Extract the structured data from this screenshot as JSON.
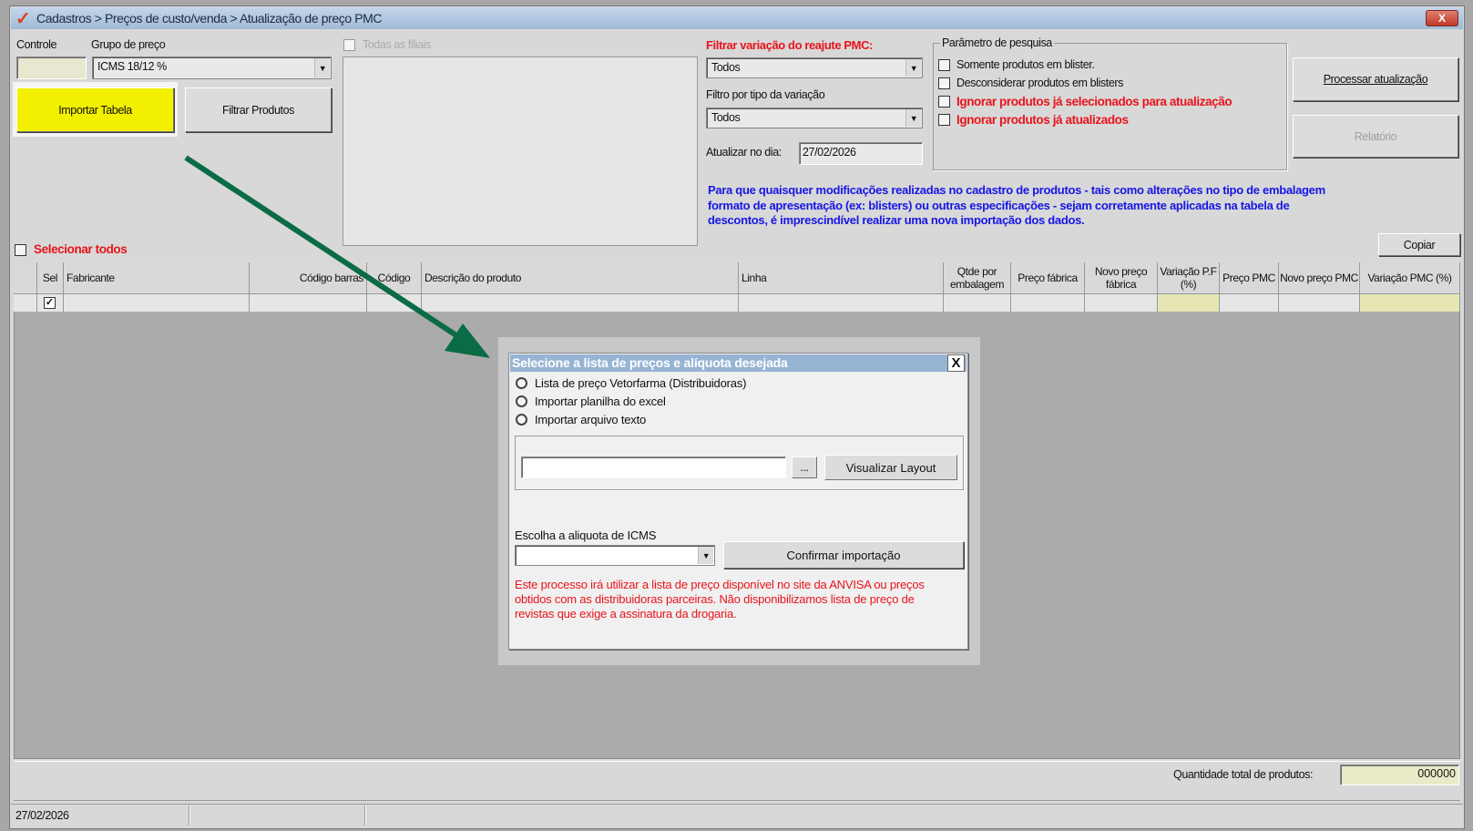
{
  "window": {
    "breadcrumb": "Cadastros > Preços de custo/venda > Atualização de preço PMC",
    "close_label": "X"
  },
  "form": {
    "controle_label": "Controle",
    "controle_value": "",
    "grupo_label": "Grupo de preço",
    "grupo_value": "ICMS 18/12 %",
    "importar_btn": "Importar Tabela",
    "filtrar_btn": "Filtrar Produtos",
    "todas_filiais": "Todas as filiais",
    "filtrar_variacao_label": "Filtrar variação do reajute PMC:",
    "filtrar_variacao_value": "Todos",
    "filtro_tipo_label": "Filtro por tipo da variação",
    "filtro_tipo_value": "Todos",
    "atualizar_label": "Atualizar no dia:",
    "atualizar_value": "27/02/2026",
    "param_title": "Parâmetro de pesquisa",
    "params": [
      "Somente produtos em blister.",
      "Desconsiderar produtos em blisters",
      "Ignorar produtos já selecionados para atualização",
      "Ignorar produtos já atualizados"
    ],
    "processar_btn": "Processar atualização",
    "relatorio_btn": "Relatório",
    "info": [
      "Para que quaisquer modificações realizadas no cadastro de produtos - tais como alterações no tipo de embalagem",
      "formato de apresentação (ex: blisters) ou outras especificações - sejam corretamente aplicadas na tabela de",
      "descontos, é imprescindível realizar uma nova importação dos dados."
    ],
    "copiar_btn": "Copiar",
    "selecionar_todos": "Selecionar todos"
  },
  "grid": {
    "columns": [
      "",
      "Sel",
      "Fabricante",
      "Código barras",
      "Código",
      "Descrição do produto",
      "Linha",
      "Qtde por embalagem",
      "Preço fábrica",
      "Novo preço fábrica",
      "Variação P.F (%)",
      "Preço PMC",
      "Novo preço PMC",
      "Variação PMC (%)"
    ],
    "highlight_color": "#e6e6b4"
  },
  "footer": {
    "qtd_label": "Quantidade total de produtos:",
    "qtd_value": "000000",
    "status_date": "27/02/2026"
  },
  "dialog": {
    "title": "Selecione a lista de preços e alíquota desejada",
    "close": "X",
    "options": [
      "Lista de preço Vetorfarma (Distribuidoras)",
      "Importar planilha do excel",
      "Importar arquivo texto"
    ],
    "file_value": "",
    "browse": "...",
    "visualizar_btn": "Visualizar Layout",
    "icms_label": "Escolha a aliquota de ICMS",
    "icms_value": "",
    "confirmar_btn": "Confirmar importação",
    "warning": [
      "Este processo irá utilizar a lista de preço disponível no site da ANVISA ou preços",
      "obtidos com as distribuidoras parceiras. Não disponibilizamos lista de preço de",
      "revistas que exige a assinatura da drogaria."
    ]
  },
  "colors": {
    "accent_yellow": "#f2f000",
    "arrow": "#0b6b45",
    "warning_red": "#e8141b",
    "info_blue": "#1616e6"
  }
}
